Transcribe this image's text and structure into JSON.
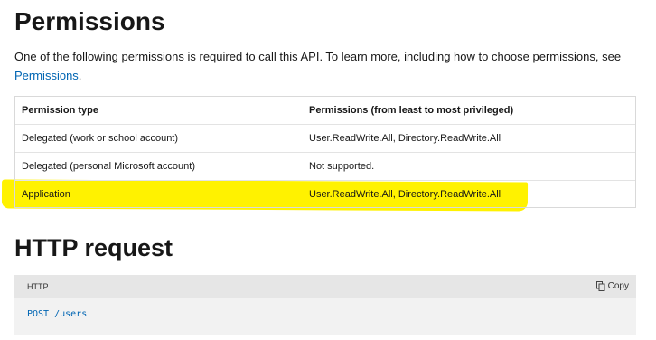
{
  "permissions": {
    "heading": "Permissions",
    "intro_text": "One of the following permissions is required to call this API. To learn more, including how to choose permissions, see",
    "intro_link": "Permissions",
    "intro_end": ".",
    "table": {
      "headers": [
        "Permission type",
        "Permissions (from least to most privileged)"
      ],
      "rows": [
        [
          "Delegated (work or school account)",
          "User.ReadWrite.All, Directory.ReadWrite.All"
        ],
        [
          "Delegated (personal Microsoft account)",
          "Not supported."
        ],
        [
          "Application",
          "User.ReadWrite.All, Directory.ReadWrite.All"
        ]
      ]
    },
    "highlight_color": "#fff200"
  },
  "http_request": {
    "heading": "HTTP request",
    "code_lang": "HTTP",
    "copy_label": "Copy",
    "copy_icon": "copy-icon",
    "code": "POST /users"
  }
}
